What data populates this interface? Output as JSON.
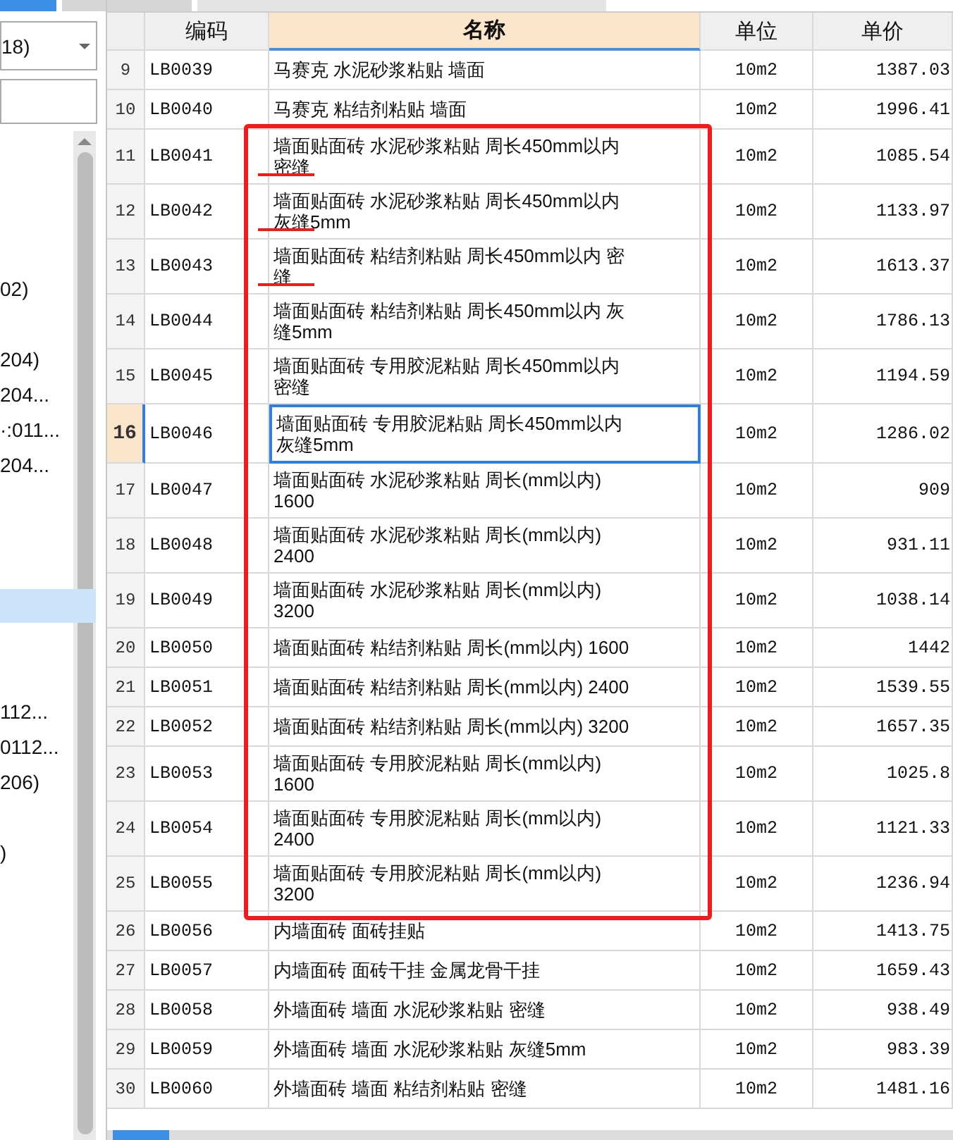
{
  "left_panel": {
    "dropdown": {
      "value": "18)"
    },
    "tree": [
      {
        "label": "02)",
        "selected": false
      },
      {
        "label": "204)",
        "selected": false
      },
      {
        "label": "204...",
        "selected": false
      },
      {
        "label": "·:011...",
        "selected": false
      },
      {
        "label": "204...",
        "selected": false
      },
      {
        "selected": true
      },
      {
        "label": "112...",
        "selected": false
      },
      {
        "label": "0112...",
        "selected": false
      },
      {
        "label": "206)",
        "selected": false
      },
      {
        "label": ")",
        "selected": false
      }
    ]
  },
  "table": {
    "columns": [
      {
        "label": "编码",
        "selected": false
      },
      {
        "label": "名称",
        "selected": true
      },
      {
        "label": "单位",
        "selected": false
      },
      {
        "label": "单价",
        "selected": false
      }
    ],
    "row_groups": [
      {
        "framed": false,
        "rows": [
          {
            "n": "9",
            "code": "LB0039",
            "name": [
              "马赛克 水泥砂浆粘贴 墙面"
            ],
            "unit": "10m2",
            "price": "1387.03",
            "selected": false,
            "underlined": false
          },
          {
            "n": "10",
            "code": "LB0040",
            "name": [
              "马赛克 粘结剂粘贴 墙面"
            ],
            "unit": "10m2",
            "price": "1996.41",
            "selected": false,
            "underlined": false
          }
        ]
      },
      {
        "framed": true,
        "rows": [
          {
            "n": "11",
            "code": "LB0041",
            "name": [
              "墙面贴面砖 水泥砂浆粘贴 周长450mm以内",
              "密缝"
            ],
            "unit": "10m2",
            "price": "1085.54",
            "selected": false,
            "underlined": true
          },
          {
            "n": "12",
            "code": "LB0042",
            "name": [
              "墙面贴面砖 水泥砂浆粘贴 周长450mm以内",
              "灰缝5mm"
            ],
            "unit": "10m2",
            "price": "1133.97",
            "selected": false,
            "underlined": true
          },
          {
            "n": "13",
            "code": "LB0043",
            "name": [
              "墙面贴面砖 粘结剂粘贴 周长450mm以内 密",
              "缝"
            ],
            "unit": "10m2",
            "price": "1613.37",
            "selected": false,
            "underlined": true
          },
          {
            "n": "14",
            "code": "LB0044",
            "name": [
              "墙面贴面砖 粘结剂粘贴 周长450mm以内 灰",
              "缝5mm"
            ],
            "unit": "10m2",
            "price": "1786.13",
            "selected": false,
            "underlined": false
          },
          {
            "n": "15",
            "code": "LB0045",
            "name": [
              "墙面贴面砖 专用胶泥粘贴 周长450mm以内",
              "密缝"
            ],
            "unit": "10m2",
            "price": "1194.59",
            "selected": false,
            "underlined": false
          },
          {
            "n": "16",
            "code": "LB0046",
            "name": [
              "墙面贴面砖 专用胶泥粘贴 周长450mm以内",
              "灰缝5mm"
            ],
            "unit": "10m2",
            "price": "1286.02",
            "selected": true,
            "underlined": false
          },
          {
            "n": "17",
            "code": "LB0047",
            "name": [
              "墙面贴面砖 水泥砂浆粘贴 周长(mm以内)",
              "1600"
            ],
            "unit": "10m2",
            "price": "909",
            "selected": false,
            "underlined": false
          },
          {
            "n": "18",
            "code": "LB0048",
            "name": [
              "墙面贴面砖 水泥砂浆粘贴 周长(mm以内)",
              "2400"
            ],
            "unit": "10m2",
            "price": "931.11",
            "selected": false,
            "underlined": false
          },
          {
            "n": "19",
            "code": "LB0049",
            "name": [
              "墙面贴面砖 水泥砂浆粘贴 周长(mm以内)",
              "3200"
            ],
            "unit": "10m2",
            "price": "1038.14",
            "selected": false,
            "underlined": false
          },
          {
            "n": "20",
            "code": "LB0050",
            "name": [
              "墙面贴面砖 粘结剂粘贴 周长(mm以内) 1600"
            ],
            "unit": "10m2",
            "price": "1442",
            "selected": false,
            "underlined": false
          },
          {
            "n": "21",
            "code": "LB0051",
            "name": [
              "墙面贴面砖 粘结剂粘贴 周长(mm以内) 2400"
            ],
            "unit": "10m2",
            "price": "1539.55",
            "selected": false,
            "underlined": false
          },
          {
            "n": "22",
            "code": "LB0052",
            "name": [
              "墙面贴面砖 粘结剂粘贴 周长(mm以内) 3200"
            ],
            "unit": "10m2",
            "price": "1657.35",
            "selected": false,
            "underlined": false
          },
          {
            "n": "23",
            "code": "LB0053",
            "name": [
              "墙面贴面砖 专用胶泥粘贴 周长(mm以内)",
              "1600"
            ],
            "unit": "10m2",
            "price": "1025.8",
            "selected": false,
            "underlined": false
          },
          {
            "n": "24",
            "code": "LB0054",
            "name": [
              "墙面贴面砖 专用胶泥粘贴 周长(mm以内)",
              "2400"
            ],
            "unit": "10m2",
            "price": "1121.33",
            "selected": false,
            "underlined": false
          },
          {
            "n": "25",
            "code": "LB0055",
            "name": [
              "墙面贴面砖 专用胶泥粘贴 周长(mm以内)",
              "3200"
            ],
            "unit": "10m2",
            "price": "1236.94",
            "selected": false,
            "underlined": false
          }
        ]
      },
      {
        "framed": false,
        "rows": [
          {
            "n": "26",
            "code": "LB0056",
            "name": [
              "内墙面砖 面砖挂贴"
            ],
            "unit": "10m2",
            "price": "1413.75",
            "selected": false,
            "underlined": false
          },
          {
            "n": "27",
            "code": "LB0057",
            "name": [
              "内墙面砖 面砖干挂 金属龙骨干挂"
            ],
            "unit": "10m2",
            "price": "1659.43",
            "selected": false,
            "underlined": false
          },
          {
            "n": "28",
            "code": "LB0058",
            "name": [
              "外墙面砖 墙面 水泥砂浆粘贴 密缝"
            ],
            "unit": "10m2",
            "price": "938.49",
            "selected": false,
            "underlined": false
          },
          {
            "n": "29",
            "code": "LB0059",
            "name": [
              "外墙面砖 墙面 水泥砂浆粘贴 灰缝5mm"
            ],
            "unit": "10m2",
            "price": "983.39",
            "selected": false,
            "underlined": false
          },
          {
            "n": "30",
            "code": "LB0060",
            "name": [
              "外墙面砖 墙面 粘结剂粘贴 密缝"
            ],
            "unit": "10m2",
            "price": "1481.16",
            "selected": false,
            "underlined": false
          }
        ]
      }
    ]
  }
}
